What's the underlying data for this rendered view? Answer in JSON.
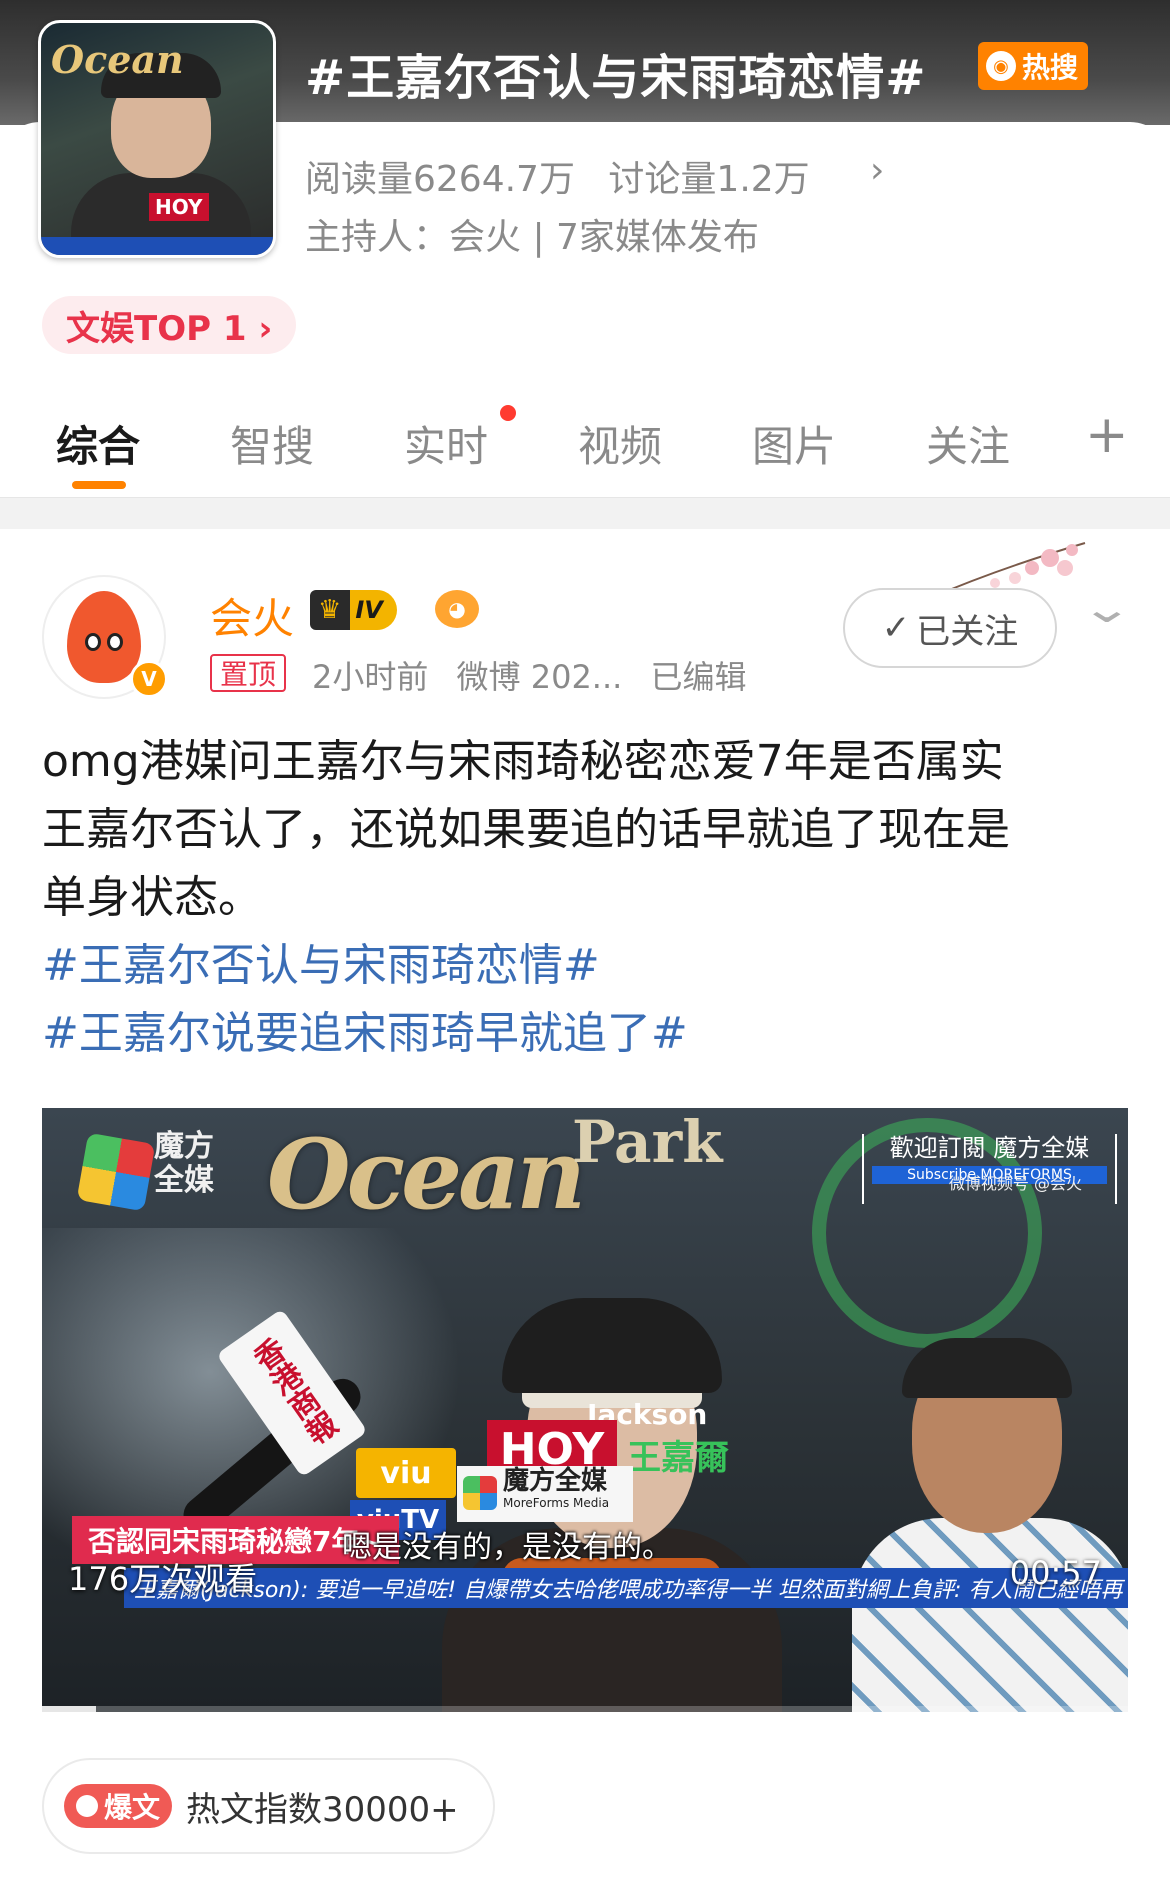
{
  "topic": {
    "title": "#王嘉尔否认与宋雨琦恋情#",
    "hot_badge": "热搜",
    "reads": "阅读量6264.7万",
    "discussions": "讨论量1.2万",
    "host": "主持人：会火 | 7家媒体发布",
    "rank": "文娱TOP 1 ›"
  },
  "tabs": [
    {
      "label": "综合",
      "active": true
    },
    {
      "label": "智搜"
    },
    {
      "label": "实时",
      "has_dot": true
    },
    {
      "label": "视频"
    },
    {
      "label": "图片"
    },
    {
      "label": "关注"
    }
  ],
  "tab_plus": "+",
  "post": {
    "author": "会火",
    "level_badge": "IV",
    "pinned_label": "置顶",
    "time": "2小时前",
    "source": "微博 202...",
    "edited": "已编辑",
    "follow_label": "已关注",
    "text_lines": [
      "omg港媒问王嘉尔与宋雨琦秘密恋爱7年是否属实",
      "王嘉尔否认了，还说如果要追的话早就追了现在是",
      "单身状态。"
    ],
    "hashtags": [
      "#王嘉尔否认与宋雨琦恋情#",
      "#王嘉尔说要追宋雨琦早就追了#"
    ]
  },
  "video": {
    "brand_line1": "魔方",
    "brand_line2": "全媒",
    "ocean": "Ocean",
    "park": "Park",
    "subscribe_cn": "歡迎訂閱 魔方全媒",
    "subscribe_en": "Subscribe MOREFORMS",
    "watermark": "微博视频号 @会火",
    "name_en": "Jackson",
    "hoy": "HOY",
    "name_cn": "王嘉爾",
    "viu": "viu",
    "viutv": "viuTV",
    "mic_card": "香港商報",
    "moreforms_cn": "魔方全媒",
    "moreforms_en": "MoreForms Media",
    "caption_red": "否認同宋雨琦秘戀7年~",
    "caption_sub": "嗯是没有的，是没有的。",
    "ticker": "王嘉爾(Jackson): 要追一早追咗! 自爆帶女去哈佬喂成功率得一半 坦然面對網上負評: 有人鬧已經唔再",
    "view_count": "176万次观看",
    "duration": "00:57",
    "progress": 0.05
  },
  "hot_pill": {
    "tag": "爆文",
    "index": "热文指数30000+"
  },
  "colors": {
    "accent": "#ff8200",
    "hashtag": "#3a6db5",
    "rank": "#e8334a",
    "gray_text": "#8a8a8a"
  },
  "icons": [
    "weibo-logo-icon",
    "chevron-right-icon",
    "plus-icon",
    "crown-icon",
    "fish-icon",
    "verified-icon",
    "check-icon",
    "chevron-down-icon",
    "flame-icon"
  ]
}
